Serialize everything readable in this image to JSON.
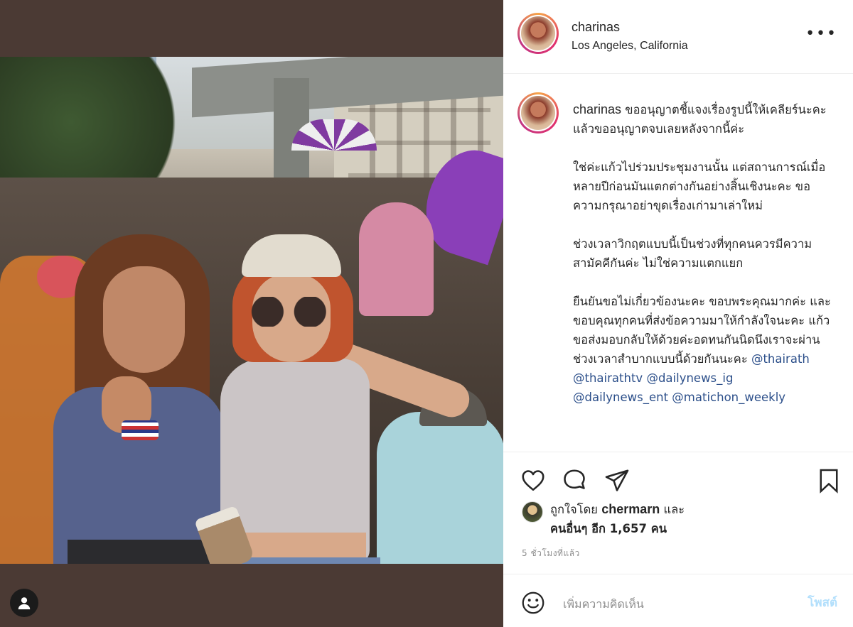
{
  "post": {
    "username": "charinas",
    "location": "Los Angeles, California",
    "more_icon": "more-horizontal-icon"
  },
  "caption": {
    "username": "charinas",
    "p1": "ขออนุญาตชี้แจงเรื่องรูปนี้ให้เคลียร์นะคะ แล้วขออนุญาตจบเลยหลังจากนี้ค่ะ",
    "p2": "ใช่ค่ะแก้วไปร่วมประชุมงานนั้น แต่สถานการณ์เมื่อหลายปีก่อนมันแตกต่างกันอย่างสิ้นเชิงนะคะ ขอความกรุณาอย่าขุดเรื่องเก่ามาเล่าใหม่",
    "p3": "ช่วงเวลาวิกฤตแบบนี้เป็นช่วงที่ทุกคนควรมีความสามัคคีกันค่ะ ไม่ใช่ความแตกแยก",
    "p4": "ยืนยันขอไม่เกี่ยวข้องนะคะ ขอบพระคุณมากค่ะ และขอบคุณทุกคนที่ส่งข้อความมาให้กำลังใจนะคะ แก้วขอส่งมอบกลับให้ด้วยค่ะอดทนกันนิดนึงเราจะผ่านช่วงเวลาสำบากแบบนี้ด้วยกันนะคะ",
    "tag1": "@thairath",
    "tag2": "@thairathtv",
    "tag3": "@dailynews_ig",
    "tag4": "@dailynews_ent",
    "tag5": "@matichon_weekly"
  },
  "likes": {
    "prefix": "ถูกใจโดย",
    "user": "chermarn",
    "conj": "และ",
    "others": "คนอื่นๆ อีก 1,657 คน"
  },
  "time": "5 ชั่วโมงที่แล้ว",
  "comment": {
    "placeholder": "เพิ่มความคิดเห็น",
    "post_label": "โพสต์"
  },
  "colors": {
    "backdrop": "#4b3a34",
    "text": "#262626",
    "secondary": "#8e8e8e",
    "post_disabled": "#b2dffc",
    "mention": "#2c4f8a"
  }
}
